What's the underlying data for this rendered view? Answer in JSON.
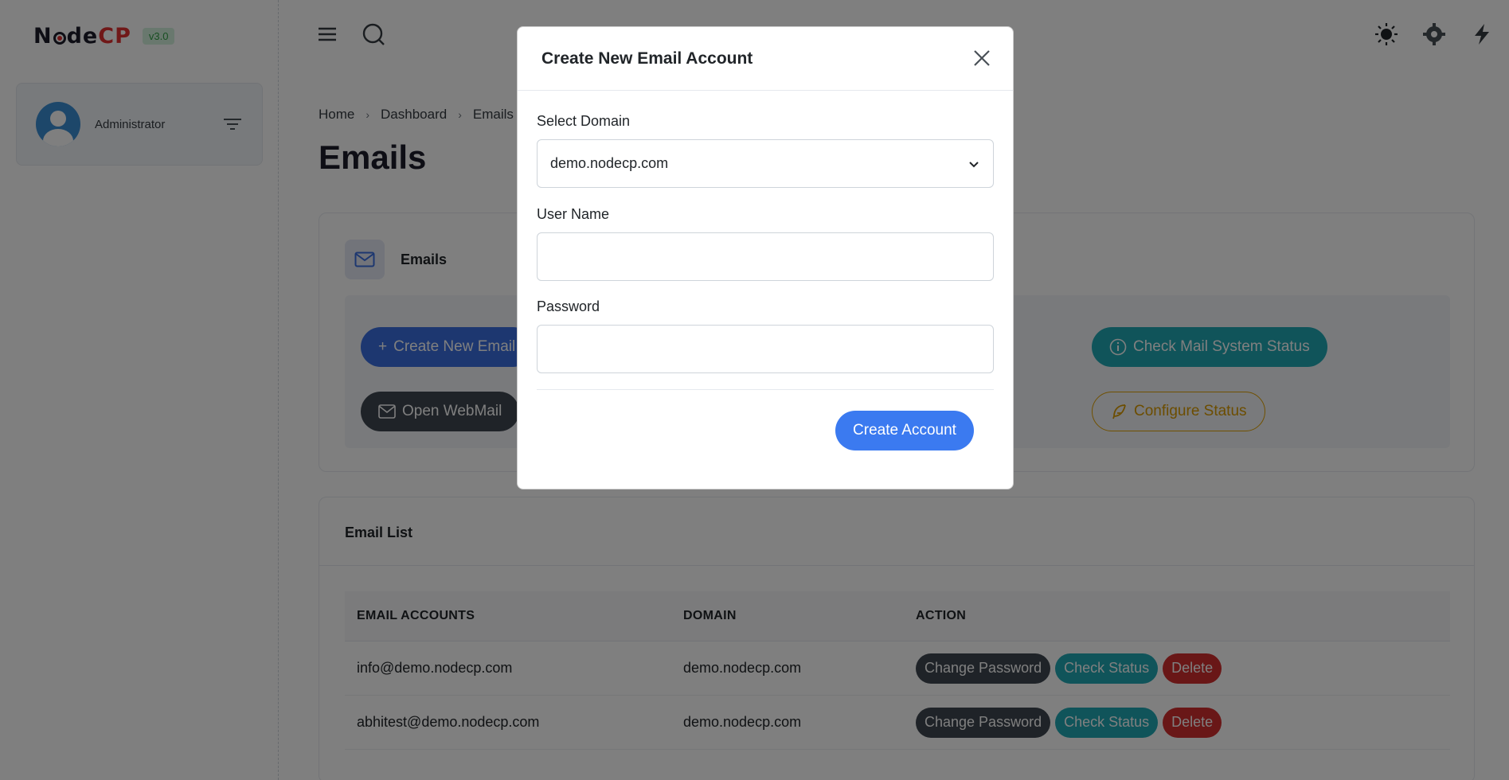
{
  "sidebar": {
    "logo": {
      "part1": "N",
      "part2": "de",
      "part3": "CP"
    },
    "version": "v3.0",
    "user": {
      "name": "Administrator"
    }
  },
  "topbar": {
    "icons": [
      "menu-icon",
      "search-icon",
      "sun-icon",
      "settings-icon",
      "bolt-icon"
    ]
  },
  "breadcrumb": {
    "items": [
      "Home",
      "Dashboard",
      "Emails"
    ]
  },
  "page": {
    "title": "Emails"
  },
  "emails_card": {
    "title": "Emails",
    "buttons": {
      "create_new_email": "Create New Email",
      "check_mail_system_status": "Check Mail System Status",
      "open_webmail": "Open WebMail",
      "configure_status": "Configure Status"
    }
  },
  "email_list": {
    "title": "Email List",
    "columns": [
      "EMAIL ACCOUNTS",
      "DOMAIN",
      "ACTION"
    ],
    "rows": [
      {
        "email": "info@demo.nodecp.com",
        "domain": "demo.nodecp.com"
      },
      {
        "email": "abhitest@demo.nodecp.com",
        "domain": "demo.nodecp.com"
      }
    ],
    "actions": {
      "change_password": "Change Password",
      "check_status": "Check Status",
      "delete": "Delete"
    }
  },
  "modal": {
    "title": "Create New Email Account",
    "select_domain_label": "Select Domain",
    "selected_domain": "demo.nodecp.com",
    "username_label": "User Name",
    "username_value": "",
    "password_label": "Password",
    "password_value": "",
    "submit_label": "Create Account"
  },
  "colors": {
    "primary": "#3b6fe0",
    "info": "#20a9b5",
    "dark": "#3e4650",
    "danger": "#d32f2f",
    "warning": "#e0a100"
  }
}
